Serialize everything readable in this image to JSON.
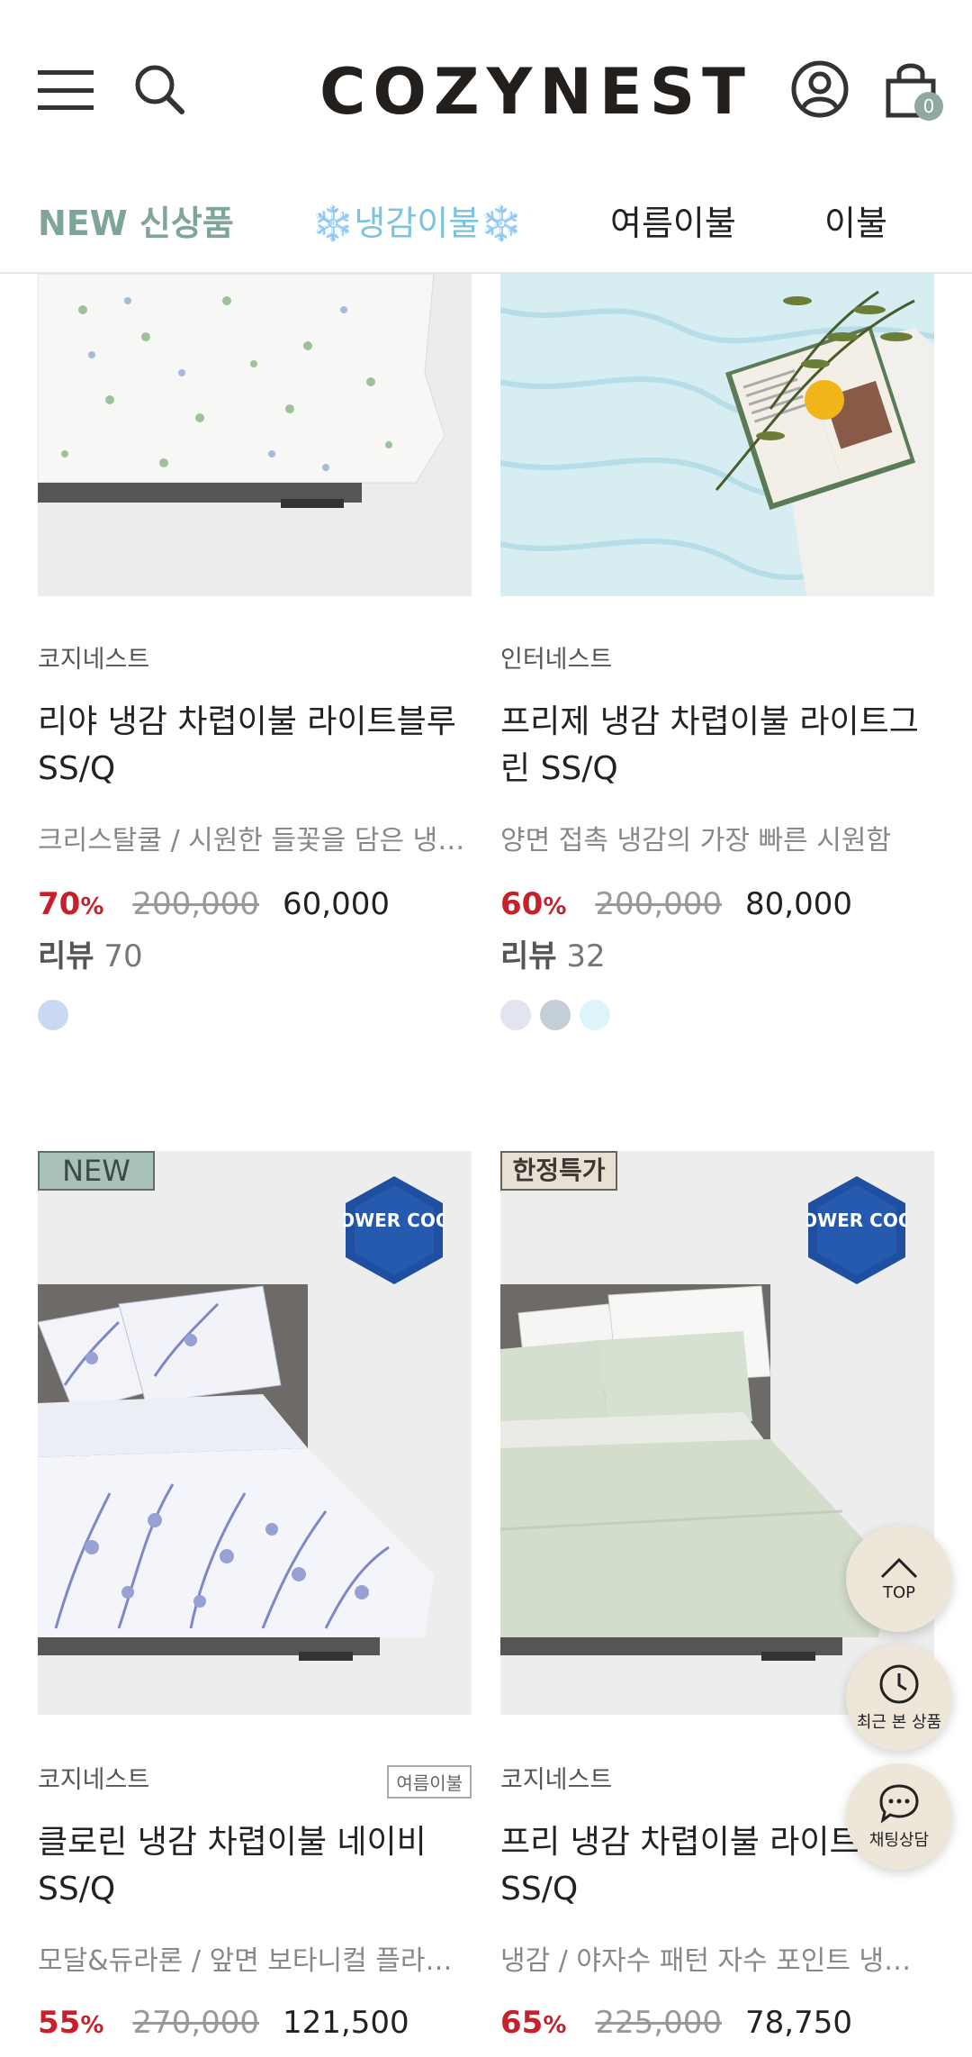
{
  "header": {
    "logo": "COZYNEST",
    "cart_count": "0",
    "icons": {
      "menu": "hamburger-icon",
      "search": "search-icon",
      "account": "user-icon",
      "cart": "shopping-bag-icon"
    }
  },
  "tabs": [
    {
      "label": "NEW 신상품"
    },
    {
      "label": "❄️냉감이불❄️"
    },
    {
      "label": "여름이불"
    },
    {
      "label": "이불"
    }
  ],
  "products": [
    {
      "brand": "코지네스트",
      "name": "리야 냉감 차렵이불 라이트블루 SS/Q",
      "desc": "크리스탈쿨 / 시원한 들꽃을 담은 냉감 차렵이불",
      "rate_num": "70",
      "rate_unit": "%",
      "original": "200,000",
      "price": "60,000",
      "review_label": "리뷰",
      "review_count": "70",
      "swatches": [
        "#c9d9f2"
      ]
    },
    {
      "brand": "인터네스트",
      "name": "프리제 냉감 차렵이불 라이트그린 SS/Q",
      "desc": "양면 접촉 냉감의 가장 빠른 시원함",
      "rate_num": "60",
      "rate_unit": "%",
      "original": "200,000",
      "price": "80,000",
      "review_label": "리뷰",
      "review_count": "32",
      "swatches": [
        "#e2e4ef",
        "#c3ced9",
        "#def4fb"
      ]
    },
    {
      "badge": "NEW",
      "power_badge": "POWER COOL",
      "brand": "코지네스트",
      "tag": "여름이불",
      "name": "클로린 냉감 차렵이불 네이비 SS/Q",
      "desc": "모달&듀라론 / 앞면 보타니컬 플라워 냉감 차렵이불",
      "rate_num": "55",
      "rate_unit": "%",
      "original": "270,000",
      "price": "121,500"
    },
    {
      "badge": "한정특가",
      "power_badge": "POWER COOL",
      "brand": "코지네스트",
      "name": "프리 냉감 차렵이불 라이트그린 SS/Q",
      "desc": "냉감 / 야자수 패턴 자수 포인트 냉감 차렵이불",
      "rate_num": "65",
      "rate_unit": "%",
      "original": "225,000",
      "price": "78,750"
    }
  ],
  "floating": {
    "top": "TOP",
    "recent": "최근 본 상품",
    "chat": "채팅상담"
  },
  "colors": {
    "accent_green": "#7fa596",
    "accent_cool": "#7cc3dd",
    "discount_red": "#c8202a",
    "fab_bg": "#ede6d9"
  }
}
